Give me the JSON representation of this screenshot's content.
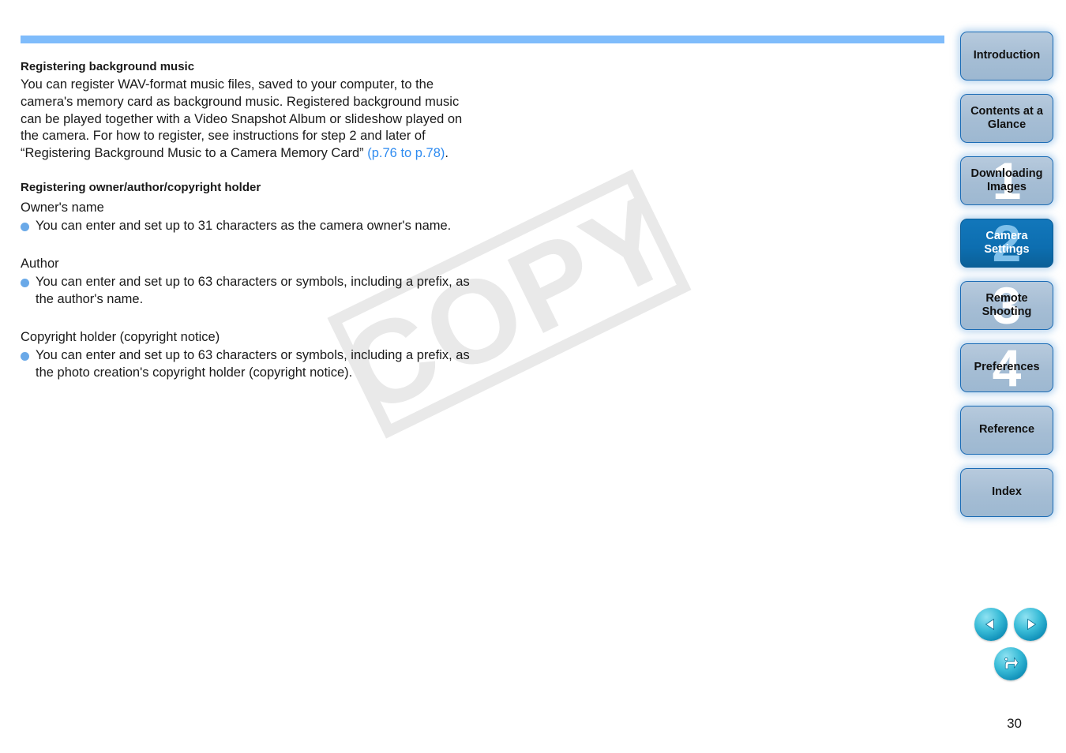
{
  "document": {
    "page_number": "30",
    "watermark_text": "COPY"
  },
  "content": {
    "section1": {
      "heading": "Registering background music",
      "paragraph_before_link": "You can register WAV-format music files, saved to your computer, to the camera's memory card as background music. Registered background music can be played together with a Video Snapshot Album or slideshow played on the camera. For how to register, see instructions for step 2 and later of “Registering Background Music to a Camera Memory Card” ",
      "link_text": "(p.76 to p.78)",
      "paragraph_after_link": "."
    },
    "section2": {
      "heading": "Registering owner/author/copyright holder",
      "groups": [
        {
          "label": "Owner's name",
          "bullet": "You can enter and set up to 31 characters as the camera owner's name."
        },
        {
          "label": "Author",
          "bullet": "You can enter and set up to 63 characters or symbols, including a prefix, as the author's name."
        },
        {
          "label": "Copyright holder (copyright notice)",
          "bullet": "You can enter and set up to 63 characters or symbols, including a prefix, as the photo creation's copyright holder (copyright notice)."
        }
      ]
    }
  },
  "sidebar": {
    "tabs": [
      {
        "label": "Introduction",
        "number": "",
        "active": false
      },
      {
        "label": "Contents at a Glance",
        "number": "",
        "active": false
      },
      {
        "label": "Downloading Images",
        "number": "1",
        "active": false
      },
      {
        "label": "Camera Settings",
        "number": "2",
        "active": true
      },
      {
        "label": "Remote Shooting",
        "number": "3",
        "active": false
      },
      {
        "label": "Preferences",
        "number": "4",
        "active": false
      },
      {
        "label": "Reference",
        "number": "",
        "active": false
      },
      {
        "label": "Index",
        "number": "",
        "active": false
      }
    ]
  },
  "navigation": {
    "previous_icon": "triangle-left-icon",
    "next_icon": "triangle-right-icon",
    "return_icon": "return-arrow-icon"
  },
  "colors": {
    "header_rule": "#7fbcfb",
    "link": "#2e8bf0",
    "bullet": "#6aa9e8",
    "tab_active": "#0d6eb0",
    "tab_inactive": "#a5bdd4",
    "nav_button": "#1596bd",
    "watermark": "#e9e9e9"
  }
}
